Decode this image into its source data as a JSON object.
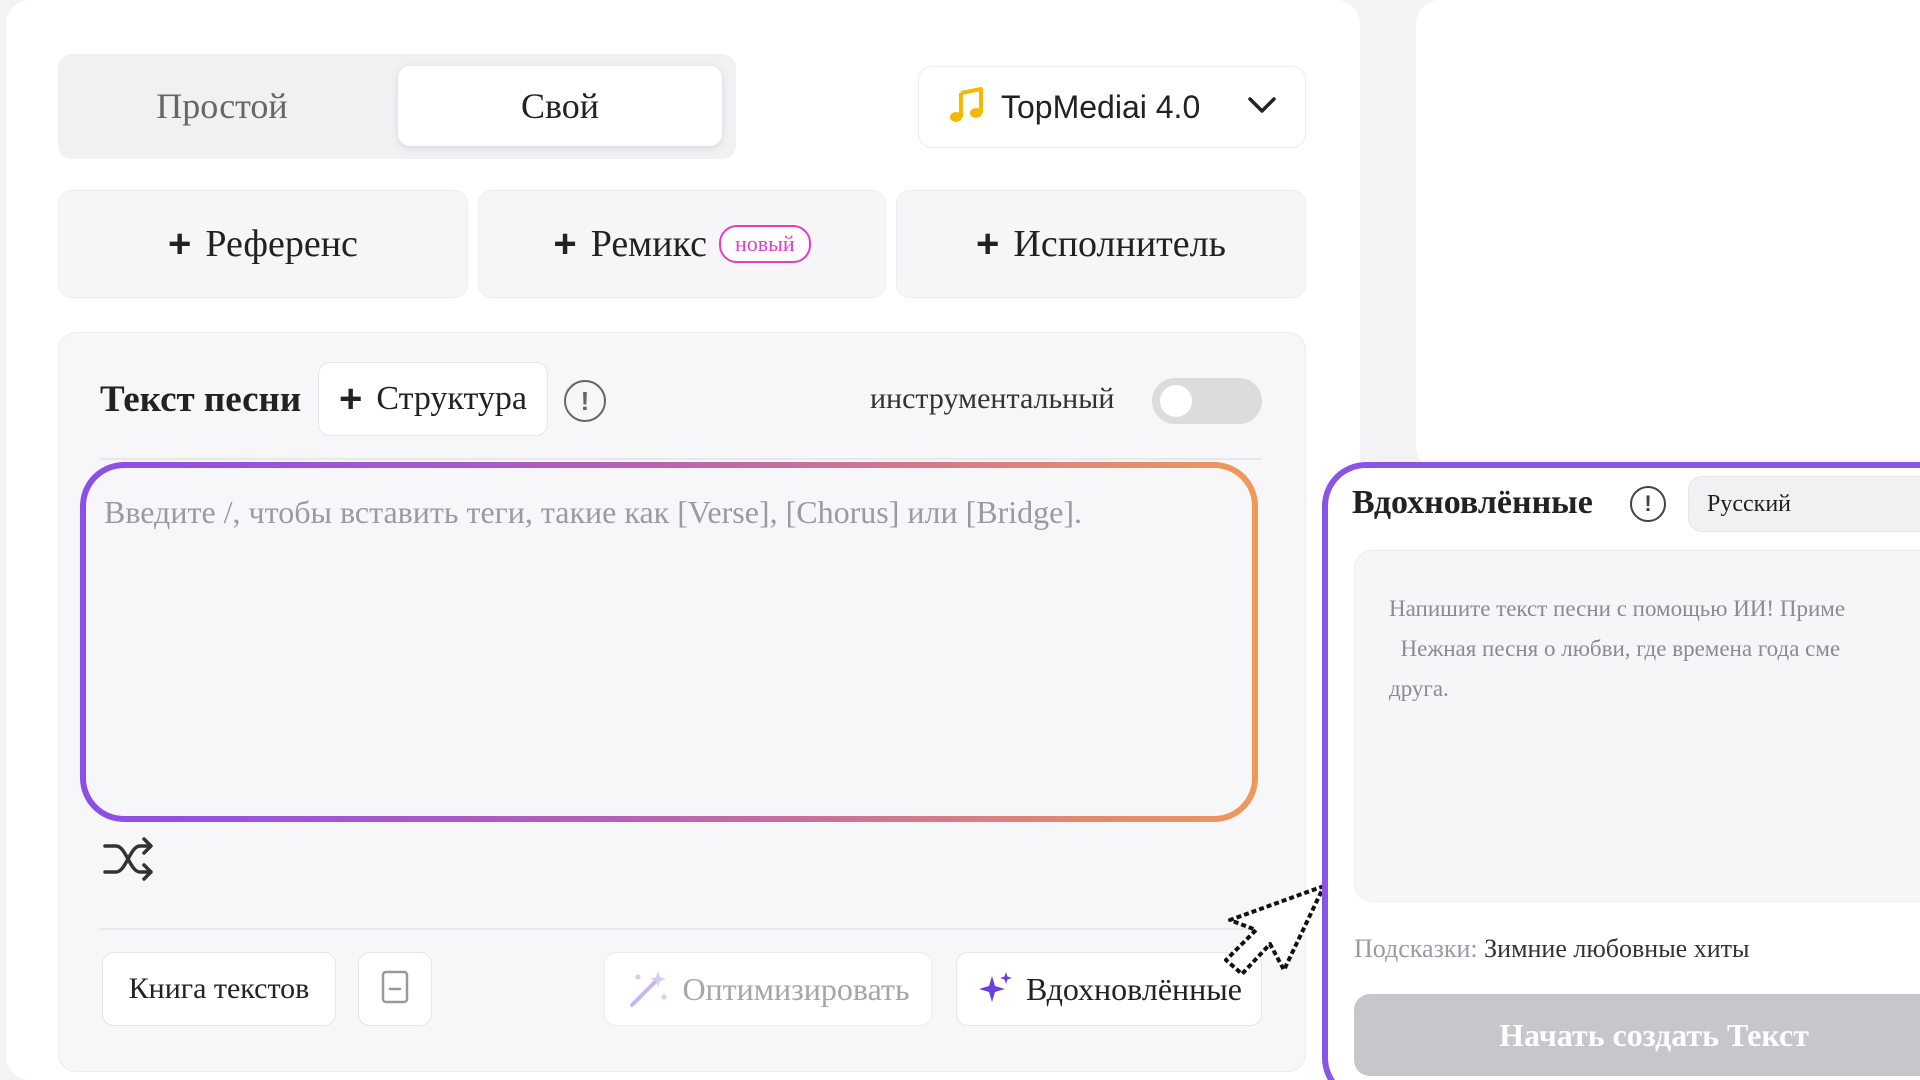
{
  "mode": {
    "simple_label": "Простой",
    "custom_label": "Свой",
    "selected": "custom"
  },
  "model": {
    "label": "TopMediai 4.0"
  },
  "add_buttons": {
    "reference": "Референс",
    "remix": "Ремикс",
    "remix_badge": "новый",
    "artist": "Исполнитель"
  },
  "lyrics": {
    "title": "Текст песни",
    "structure_label": "Структура",
    "instrumental_label": "инструментальный",
    "instrumental_on": false,
    "placeholder": "Введите /, чтобы вставить теги, такие как [Verse], [Chorus] или [Bridge]."
  },
  "actions": {
    "lyrics_book": "Книга текстов",
    "optimize": "Оптимизировать",
    "inspired": "Вдохновлённые"
  },
  "inspire_panel": {
    "title": "Вдохновлённые",
    "language": "Русский",
    "placeholder": "Напишите текст песни с помощью ИИ! Приме\n  Нежная песня о любви, где времена года сме\nдруга.",
    "hints_label": "Подсказки:",
    "hints_value": "Зимние любовные хиты",
    "create_label": "Начать создать Текст"
  },
  "colors": {
    "accent_purple": "#8a55e4",
    "accent_orange": "#f0985a",
    "badge_pink": "#e53bc9",
    "disabled_button": "#c6c6cb"
  },
  "icons": [
    "music-note-icon",
    "chevron-down-icon",
    "plus-icon",
    "info-icon",
    "shuffle-icon",
    "bookmark-icon",
    "magic-wand-icon",
    "sparkle-icon",
    "cursor-icon"
  ]
}
